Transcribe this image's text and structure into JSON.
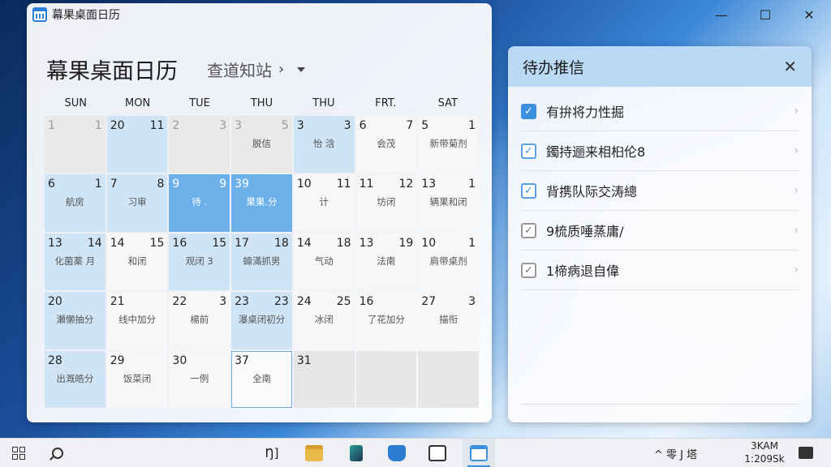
{
  "window": {
    "title": "幕果桌面日历",
    "minimize": "—",
    "maximize": "☐",
    "close": "✕"
  },
  "calendar": {
    "title": "幕果桌面日历",
    "subtitle": "查道知站",
    "chevron": "›",
    "weekdays": [
      "SUN",
      "MON",
      "TUE",
      "THU",
      "THU",
      "FRT.",
      "SAT"
    ],
    "cells": [
      {
        "d1": "1",
        "d2": "1",
        "ev": "",
        "style": "grey"
      },
      {
        "d1": "20",
        "d2": "11",
        "ev": "",
        "style": "light"
      },
      {
        "d1": "2",
        "d2": "3",
        "ev": "",
        "style": "grey"
      },
      {
        "d1": "3",
        "d2": "5",
        "ev": "脱信",
        "style": "grey"
      },
      {
        "d1": "3",
        "d2": "3",
        "ev": "怡   浛",
        "style": "light"
      },
      {
        "d1": "6",
        "d2": "7",
        "ev": "会茂",
        "style": "white"
      },
      {
        "d1": "5",
        "d2": "1",
        "ev": "新带菊剂",
        "style": "white"
      },
      {
        "d1": "6",
        "d2": "1",
        "ev": "航房",
        "style": "light"
      },
      {
        "d1": "7",
        "d2": "8",
        "ev": "习审",
        "style": "light"
      },
      {
        "d1": "9",
        "d2": "9",
        "ev": "待   .",
        "style": "blue"
      },
      {
        "d1": "39",
        "d2": "",
        "ev": "果果.分",
        "style": "blue"
      },
      {
        "d1": "10",
        "d2": "11",
        "ev": "计",
        "style": "white"
      },
      {
        "d1": "11",
        "d2": "12",
        "ev": "坊闭",
        "style": "white"
      },
      {
        "d1": "13",
        "d2": "1",
        "ev": "辆果和闭",
        "style": "white"
      },
      {
        "d1": "13",
        "d2": "14",
        "ev": "化菌薬   月",
        "style": "light"
      },
      {
        "d1": "14",
        "d2": "15",
        "ev": "和闭",
        "style": "white"
      },
      {
        "d1": "16",
        "d2": "15",
        "ev": "观闭   3",
        "style": "light"
      },
      {
        "d1": "17",
        "d2": "18",
        "ev": "蟑滿抓男",
        "style": "light"
      },
      {
        "d1": "14",
        "d2": "18",
        "ev": "气动",
        "style": "white"
      },
      {
        "d1": "13",
        "d2": "19",
        "ev": "法南",
        "style": "white"
      },
      {
        "d1": "10",
        "d2": "1",
        "ev": "肩带桌剂",
        "style": "white"
      },
      {
        "d1": "20",
        "d2": "",
        "ev": "瀬懒抽分",
        "style": "light"
      },
      {
        "d1": "21",
        "d2": "",
        "ev": "线中加分",
        "style": "white"
      },
      {
        "d1": "22",
        "d2": "3",
        "ev": "楊前",
        "style": "white"
      },
      {
        "d1": "23",
        "d2": "23",
        "ev": "瀑桌闭初分",
        "style": "light"
      },
      {
        "d1": "24",
        "d2": "25",
        "ev": "冰闭",
        "style": "white"
      },
      {
        "d1": "16",
        "d2": "",
        "ev": "了花加分",
        "style": "white"
      },
      {
        "d1": "27",
        "d2": "3",
        "ev": "描衔",
        "style": "white"
      },
      {
        "d1": "28",
        "d2": "",
        "ev": "出溉皓分",
        "style": "light"
      },
      {
        "d1": "29",
        "d2": "",
        "ev": "饭菜闭",
        "style": "white"
      },
      {
        "d1": "30",
        "d2": "",
        "ev": "一例",
        "style": "white"
      },
      {
        "d1": "37",
        "d2": "",
        "ev": "全南",
        "style": "sel"
      },
      {
        "d1": "31",
        "d2": "",
        "ev": "",
        "style": "empty"
      },
      {
        "d1": "",
        "d2": "",
        "ev": "",
        "style": "empty"
      },
      {
        "d1": "",
        "d2": "",
        "ev": "",
        "style": "empty"
      }
    ]
  },
  "todo": {
    "title": "待办推信",
    "close": "✕",
    "items": [
      {
        "text": "有拚将力性掘",
        "check": "filled"
      },
      {
        "text": "鐲持逦来相桕伦8",
        "check": "outline"
      },
      {
        "text": "背携队际交涛總",
        "check": "outline"
      },
      {
        "text": "9梳质唾蒸庸/",
        "check": "grey"
      },
      {
        "text": "1楴病退自偉",
        "check": "grey"
      }
    ],
    "chevron": "›"
  },
  "taskbar": {
    "clock_time": "3KAM",
    "clock_date": "1:209Sk",
    "tray_text": "^ 零 J 塔",
    "book_label": "Ŋ]",
    "colors": {
      "accent": "#3d8fe0",
      "folder": "#e9b949",
      "store": "#2e7cd1"
    }
  }
}
